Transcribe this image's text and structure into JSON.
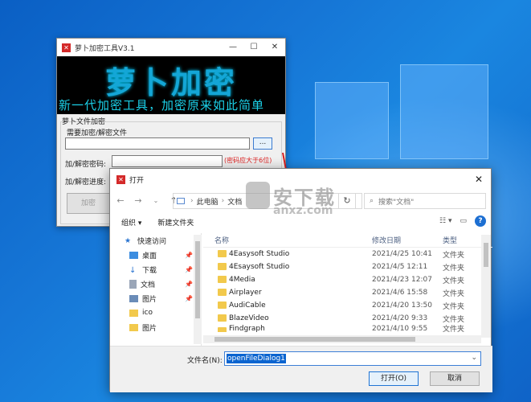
{
  "app": {
    "title": "萝卜加密工具V3.1",
    "banner_title": "萝卜加密",
    "banner_subtitle": "新一代加密工具，加密原来如此简单",
    "group_label": "萝卜文件加密",
    "file_label": "需要加密/解密文件",
    "browse_label": "...",
    "password_label": "加/解密密码:",
    "password_hint": "(密码应大于6位)",
    "progress_label": "加/解密进度:",
    "action_button": "加密"
  },
  "dialog": {
    "title": "打开",
    "breadcrumb": [
      "此电脑",
      "文档"
    ],
    "search_placeholder": "搜索\"文档\"",
    "toolbar": {
      "organize": "组织 ▾",
      "new_folder": "新建文件夹"
    },
    "nav_tree": [
      {
        "label": "快速访问",
        "icon": "star-icon",
        "pinned": false
      },
      {
        "label": "桌面",
        "icon": "desktop-icon",
        "pinned": true
      },
      {
        "label": "下载",
        "icon": "download-icon",
        "pinned": true
      },
      {
        "label": "文档",
        "icon": "document-icon",
        "pinned": true
      },
      {
        "label": "图片",
        "icon": "picture-icon",
        "pinned": true
      },
      {
        "label": "ico",
        "icon": "folder-icon",
        "pinned": false
      },
      {
        "label": "图片",
        "icon": "folder-icon",
        "pinned": false
      }
    ],
    "columns": {
      "name": "名称",
      "date": "修改日期",
      "type": "类型"
    },
    "files": [
      {
        "name": "4Easysoft Studio",
        "date": "2021/4/25 10:41",
        "type": "文件夹"
      },
      {
        "name": "4Esaysoft Studio",
        "date": "2021/4/5 12:11",
        "type": "文件夹"
      },
      {
        "name": "4Media",
        "date": "2021/4/23 12:07",
        "type": "文件夹"
      },
      {
        "name": "Airplayer",
        "date": "2021/4/6 15:58",
        "type": "文件夹"
      },
      {
        "name": "AudiCable",
        "date": "2021/4/20 13:50",
        "type": "文件夹"
      },
      {
        "name": "BlazeVideo",
        "date": "2021/4/20 9:33",
        "type": "文件夹"
      },
      {
        "name": "Findgraph",
        "date": "2021/4/10 9:55",
        "type": "文件夹"
      }
    ],
    "filename_label": "文件名(N):",
    "filename_value": "openFileDialog1",
    "open_button": "打开(O)",
    "cancel_button": "取消"
  },
  "watermark": {
    "text": "安下载",
    "url": "anxz.com"
  },
  "colors": {
    "accent": "#0a64d0",
    "banner_text": "#14a6d6",
    "hint": "#dd2222"
  }
}
